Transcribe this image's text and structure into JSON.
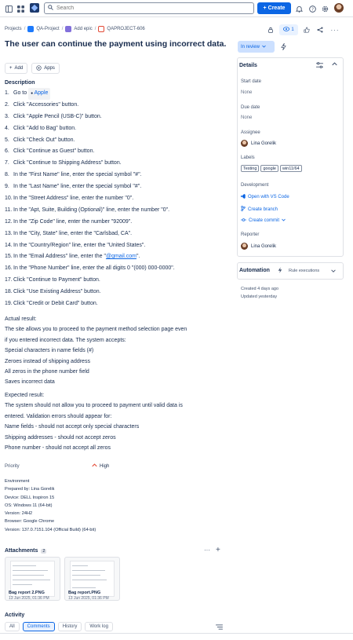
{
  "search": {
    "placeholder": "Search"
  },
  "topbar": {
    "create_label": "Create"
  },
  "breadcrumb": [
    "Projects",
    "QA-Project",
    "Add epic",
    "QAPROJECT-606"
  ],
  "watchers_count": "1",
  "issue": {
    "title": "The user can continue the payment using incorrect data.",
    "add_label": "Add",
    "apps_label": "Apps",
    "description_heading": "Description"
  },
  "steps": [
    {
      "n": "1.",
      "pre": "Go to ",
      "link": "Apple",
      "post": ""
    },
    {
      "n": "2.",
      "pre": "Click \"Accessories\" button.",
      "link": "",
      "post": ""
    },
    {
      "n": "3.",
      "pre": "Click \"Apple Pencil (USB-C)\" button.",
      "link": "",
      "post": ""
    },
    {
      "n": "4.",
      "pre": "Click \"Add to Bag\" button.",
      "link": "",
      "post": ""
    },
    {
      "n": "5.",
      "pre": "Click \"Check Out\" button.",
      "link": "",
      "post": ""
    },
    {
      "n": "6.",
      "pre": "Click \"Continue as Guest\" button.",
      "link": "",
      "post": ""
    },
    {
      "n": "7.",
      "pre": "Click \"Continue to Shipping Address\" button.",
      "link": "",
      "post": ""
    },
    {
      "n": "8.",
      "pre": "In the \"First Name\" line, enter the special symbol \"#\".",
      "link": "",
      "post": ""
    },
    {
      "n": "9.",
      "pre": "In the \"Last Name\" line, enter the special symbol \"#\".",
      "link": "",
      "post": ""
    },
    {
      "n": "10.",
      "pre": "In the \"Street Address\" line, enter the number \"0\".",
      "link": "",
      "post": ""
    },
    {
      "n": "11.",
      "pre": "In the \"Apt, Suite, Building (Optional)\" line, enter the number \"0\".",
      "link": "",
      "post": ""
    },
    {
      "n": "12.",
      "pre": "In the \"Zip Code\" line, enter the number \"92009\".",
      "link": "",
      "post": ""
    },
    {
      "n": "13.",
      "pre": "In the \"City, State\" line, enter the \"Carlsbad, CA\".",
      "link": "",
      "post": ""
    },
    {
      "n": "14.",
      "pre": "In the \"Country/Region\" line, enter the \"United States\".",
      "link": "",
      "post": ""
    },
    {
      "n": "15.",
      "pre": "In the \"Email Address\" line, enter the \"",
      "link": "@gmail.com",
      "post": "\"."
    },
    {
      "n": "16.",
      "pre": "In the \"Phone Number\" line, enter the all digits 0 \"(000) 000-0000\".",
      "link": "",
      "post": ""
    },
    {
      "n": "17.",
      "pre": "Click \"Continue to Payment\" button.",
      "link": "",
      "post": ""
    },
    {
      "n": "18.",
      "pre": "Click \"Use Existing Address\" button.",
      "link": "",
      "post": ""
    },
    {
      "n": "19.",
      "pre": "Click \"Credit or Debit Card\" button.",
      "link": "",
      "post": ""
    }
  ],
  "actual": [
    "Actual result:",
    "The site allows you to proceed to the payment method selection page even",
    "if you entered incorrect data. The system accepts:",
    "Special characters in name fields (#)",
    "Zeroes instead of shipping address",
    "All zeros in the phone number field",
    "Saves incorrect data"
  ],
  "expected": [
    "Expected result:",
    "The system should not allow you to proceed to payment until valid data is",
    "entered. Validation errors should appear for:",
    "Name fields - should not accept only special characters",
    "Shipping addresses - should not accept zeros",
    "Phone number - should not accept all zeros"
  ],
  "priority": {
    "label": "Priority",
    "value": "High"
  },
  "environment": [
    "Environment",
    "Prepared by: Lina Gorelik",
    "Device: DELL Inspiron 15",
    "OS: Windows 11 (64-bit)",
    "Version: 24H2",
    "Browser: Google Chrome",
    "Version: 137.0.7151.104 (Official Build) (64-bit)"
  ],
  "attachments": {
    "heading": "Attachments",
    "count": "2",
    "files": [
      {
        "name": "Bag report 2.PNG",
        "date": "13 Jun 2025, 01:36 PM"
      },
      {
        "name": "Bag report.PNG",
        "date": "13 Jun 2025, 01:36 PM"
      }
    ]
  },
  "activity": {
    "heading": "Activity",
    "tabs": [
      "All",
      "Comments",
      "History",
      "Work log"
    ],
    "active_tab": "Comments"
  },
  "status": {
    "label": "In review"
  },
  "details": {
    "heading": "Details",
    "start_date_label": "Start date",
    "start_date_value": "None",
    "due_date_label": "Due date",
    "due_date_value": "None",
    "assignee_label": "Assignee",
    "assignee_value": "Lina Gorelik",
    "labels_label": "Labels",
    "labels": [
      "Testing",
      "google",
      "win11/64"
    ],
    "development_label": "Development",
    "dev_links": [
      "Open with VS Code",
      "Create branch",
      "Create commit"
    ],
    "reporter_label": "Reporter",
    "reporter_value": "Lina Gorelik"
  },
  "automation": {
    "heading": "Automation",
    "rule_label": "Rule executions"
  },
  "meta": {
    "created": "Created 4 days ago",
    "updated": "Updated yesterday"
  },
  "colors": {
    "accent": "#0c66e4",
    "text": "#172b4d",
    "priority_high": "#e34935"
  }
}
